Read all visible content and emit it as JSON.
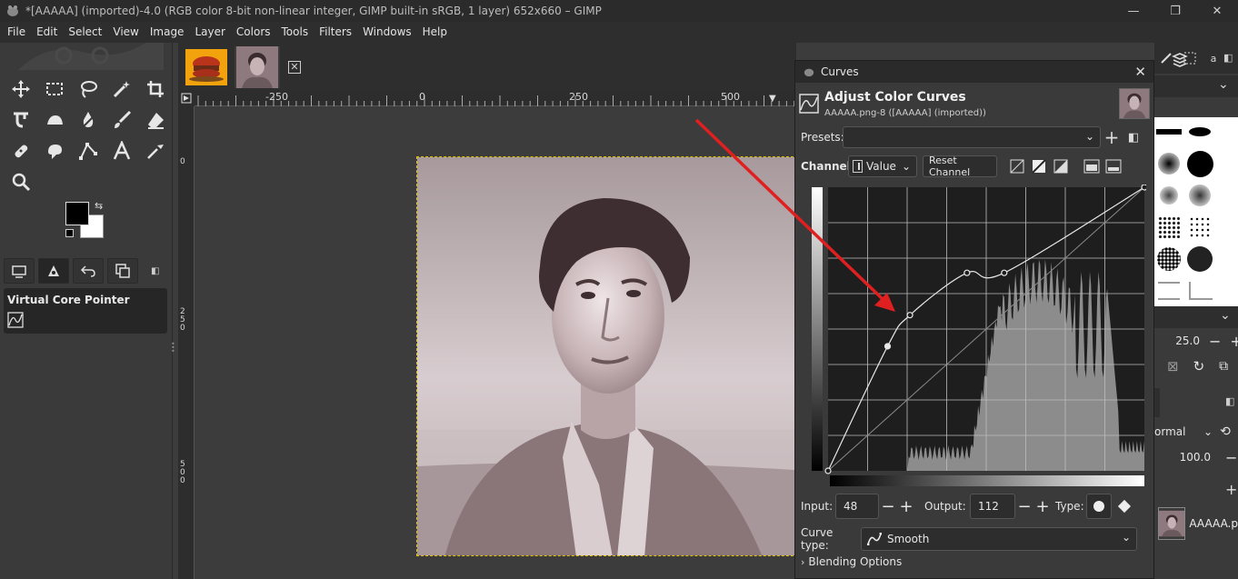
{
  "window": {
    "title": "*[AAAAA] (imported)-4.0 (RGB color 8-bit non-linear integer, GIMP built-in sRGB, 1 layer) 652x660 – GIMP",
    "min_glyph": "—",
    "max_glyph": "❐",
    "close_glyph": "✕"
  },
  "menu": [
    "File",
    "Edit",
    "Select",
    "View",
    "Image",
    "Layer",
    "Colors",
    "Tools",
    "Filters",
    "Windows",
    "Help"
  ],
  "toolbox": {
    "tools": [
      "move-tool-icon",
      "rect-select-icon",
      "lasso-icon",
      "fuzzy-select-icon",
      "crop-icon",
      "warp-icon",
      "bucket-icon",
      "ink-icon",
      "paintbrush-icon",
      "eraser-icon",
      "heal-icon",
      "smudge-icon",
      "path-icon",
      "text-icon",
      "color-picker-icon",
      "zoom-icon"
    ],
    "device_status_label": "Virtual Core Pointer",
    "fg_color": "#000000",
    "bg_color": "#ffffff"
  },
  "image_tabs": [
    "burger-thumbnail",
    "portrait-thumbnail"
  ],
  "rulers": {
    "h_labels": [
      "-250",
      "0",
      "250",
      "500"
    ],
    "v_labels": [
      "0",
      "250",
      "500"
    ]
  },
  "curves": {
    "dialog_title": "Curves",
    "heading": "Adjust Color Curves",
    "subheading": "AAAAA.png-8 ([AAAAA] (imported))",
    "presets_label": "Presets:",
    "presets_value": "",
    "channel_label": "Channel:",
    "channel_value": "Value",
    "reset_channel_label": "Reset Channel",
    "input_label": "Input:",
    "input_value": "48",
    "output_label": "Output:",
    "output_value": "112",
    "type_label": "Type:",
    "curve_type_label": "Curve type:",
    "curve_type_value": "Smooth",
    "blending_options_label": "Blending Options",
    "control_points": [
      [
        0,
        0
      ],
      [
        48,
        112
      ],
      [
        66,
        140
      ],
      [
        112,
        178
      ],
      [
        142,
        178
      ],
      [
        255,
        255
      ]
    ],
    "selected_point": [
      48,
      112
    ]
  },
  "right_dock": {
    "brush_size_value": "25.0",
    "mode_value": "ormal",
    "opacity_value": "100.0",
    "layer_name": "AAAAA.p"
  },
  "annotation": {
    "arrow_color": "#e02020"
  }
}
